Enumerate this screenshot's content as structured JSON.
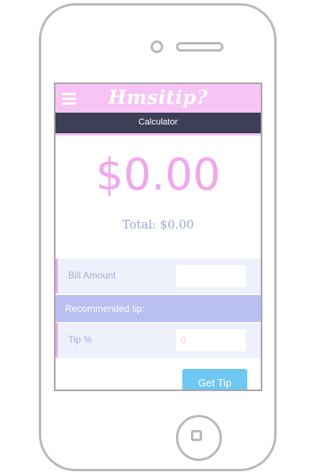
{
  "app": {
    "logo_text": "Hmsitip?",
    "brand_color": "#f8c3f5",
    "nav_color": "#3c3f55"
  },
  "header": {
    "menu_icon": "hamburger-menu-icon"
  },
  "nav": {
    "title": "Calculator"
  },
  "result": {
    "tip_amount": "$0.00",
    "total_text": "Total: $0.00"
  },
  "form": {
    "bill_label": "Bill Amount",
    "bill_value": "",
    "recommended_label": "Recommended tip:",
    "tip_percent_label": "Tip %",
    "tip_percent_placeholder": "0",
    "submit_label": "Get Tip",
    "button_color": "#6fc8f2"
  }
}
